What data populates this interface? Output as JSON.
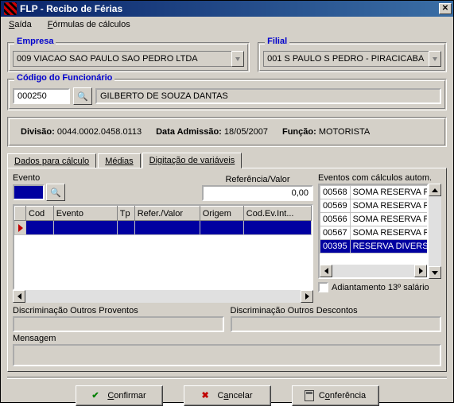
{
  "title": "FLP - Recibo de Férias",
  "menu": {
    "saida": "Saída",
    "formulas": "Fórmulas de cálculos"
  },
  "empresa": {
    "label": "Empresa",
    "value": "009 VIACAO SAO PAULO SAO PEDRO LTDA"
  },
  "filial": {
    "label": "Filial",
    "value": "001 S PAULO S PEDRO - PIRACICABA"
  },
  "codigo": {
    "label": "Código do Funcionário",
    "code": "000250",
    "name": "GILBERTO DE SOUZA DANTAS"
  },
  "info": {
    "divisao_label": "Divisão:",
    "divisao_value": "0044.0002.0458.0113",
    "admissao_label": "Data Admissão:",
    "admissao_value": "18/05/2007",
    "funcao_label": "Função:",
    "funcao_value": "MOTORISTA"
  },
  "tabs": {
    "dados": "Dados para cálculo",
    "medias": "Médias",
    "digitacao": "Digitação de variáveis"
  },
  "evento_label": "Evento",
  "ref_label": "Referência/Valor",
  "ref_value": "0,00",
  "grid_headers": [
    "Cod",
    "Evento",
    "Tp",
    "Refer./Valor",
    "Origem",
    "Cod.Ev.Int..."
  ],
  "right_label": "Eventos com cálculos autom.",
  "right_rows": [
    {
      "code": "00568",
      "desc": "SOMA RESERVA FE..",
      "sel": false
    },
    {
      "code": "00569",
      "desc": "SOMA RESERVA FE..",
      "sel": false
    },
    {
      "code": "00566",
      "desc": "SOMA RESERVA FE..",
      "sel": false
    },
    {
      "code": "00567",
      "desc": "SOMA RESERVA FE..",
      "sel": false
    },
    {
      "code": "00395",
      "desc": "RESERVA DIVERSA..",
      "sel": true
    }
  ],
  "adiantamento_label": "Adiantamento 13º  salário",
  "disc_prov_label": "Discriminação Outros Proventos",
  "disc_desc_label": "Discriminação Outros Descontos",
  "mensagem_label": "Mensagem",
  "buttons": {
    "confirmar": "Confirmar",
    "cancelar": "Cancelar",
    "conferencia": "Conferência"
  }
}
